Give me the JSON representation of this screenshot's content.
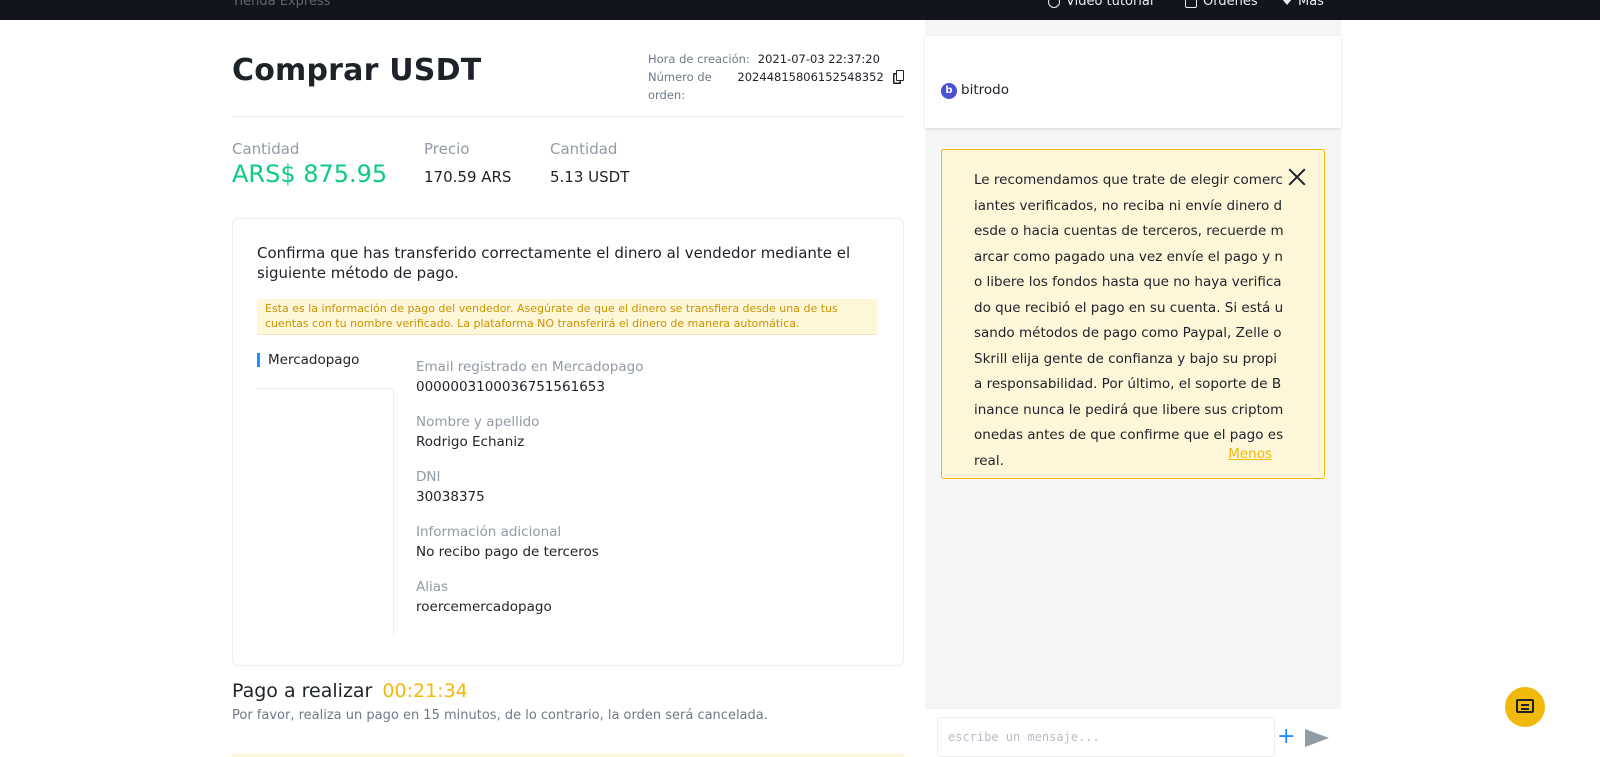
{
  "topnav": {
    "left_text": "Tienda    Express",
    "items": [
      "Video tutorial",
      "Órdenes",
      "Más"
    ]
  },
  "order": {
    "title": "Comprar USDT",
    "created_label": "Hora de creación:",
    "created_value": "2021-07-03 22:37:20",
    "number_label": "Número de orden:",
    "number_value": "20244815806152548352"
  },
  "stats": {
    "amount_label": "Cantidad",
    "amount_value": "ARS$ 875.95",
    "price_label": "Precio",
    "price_value": "170.59 ARS",
    "qty_label": "Cantidad",
    "qty_value": "5.13 USDT"
  },
  "payment": {
    "instruction": "Confirma que has transferido correctamente el dinero al vendedor mediante el siguiente método de pago.",
    "warning": "Esta es la información de pago del vendedor. Asegúrate de que el dinero se transfiera desde una de tus cuentas con tu nombre verificado. La plataforma NO transferirá el dinero de manera automática.",
    "method": "Mercadopago",
    "fields": [
      {
        "label": "Email registrado en Mercadopago",
        "value": "0000003100036751561653"
      },
      {
        "label": "Nombre y apellido",
        "value": "Rodrigo Echaniz"
      },
      {
        "label": "DNI",
        "value": "30038375"
      },
      {
        "label": "Información adicional",
        "value": "No recibo pago de terceros"
      },
      {
        "label": "Alias",
        "value": "roercemercadopago"
      }
    ]
  },
  "pay_due": {
    "label": "Pago a realizar",
    "timer": "00:21:34",
    "note": "Por favor, realiza un pago en 15 minutos, de lo contrario, la orden será cancelada."
  },
  "chat": {
    "avatar_letter": "b",
    "username": "bitrodo",
    "notice": "Le recomendamos que trate de elegir comerciantes verificados, no reciba ni envíe dinero desde o hacia cuentas de terceros, recuerde marcar como pagado una vez envíe el pago y no libere los fondos hasta que no haya verificado que recibió el pago en su cuenta. Si está usando métodos de pago como Paypal, Zelle o Skrill elija gente de confianza y bajo su propia responsabilidad. Por último, el soporte de Binance nunca le pedirá que libere sus criptomonedas antes de que confirme que el pago es real.",
    "less_link": "Menos",
    "input_placeholder": "escribe un mensaje..."
  },
  "colors": {
    "accent": "#f0b90b",
    "positive": "#0ecb81",
    "link_blue": "#1e90ff"
  }
}
